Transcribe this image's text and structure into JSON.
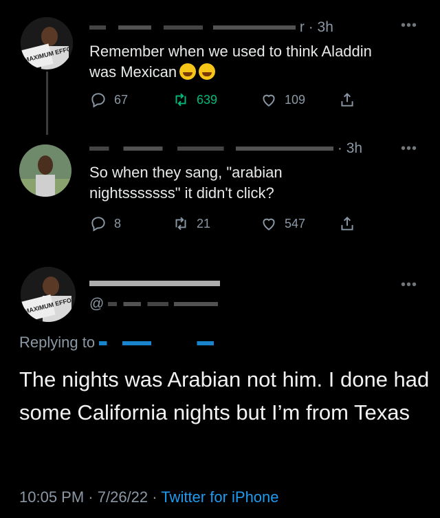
{
  "tweets": [
    {
      "time": "3h",
      "author_suffix": "r",
      "text_line1": "Remember when we used to think Aladdin",
      "text_line2": "was Mexican",
      "replies": "67",
      "retweets": "639",
      "likes": "109",
      "avatar_text": "MAXIMUM EFFORT"
    },
    {
      "time": "3h",
      "text_line1": "So when they sang, \"arabian",
      "text_line2": "nightsssssss\" it didn't click?",
      "replies": "8",
      "retweets": "21",
      "likes": "547"
    }
  ],
  "main_tweet": {
    "handle_prefix": "@",
    "avatar_text": "MAXIMUM EFFORT",
    "replying_label": "Replying to",
    "text": "The nights was Arabian not him. I done had some California nights but I’m from Texas",
    "time": "10:05 PM",
    "date": "7/26/22",
    "source": "Twitter for iPhone"
  },
  "colors": {
    "background": "#000000",
    "text": "#e7e9ea",
    "muted": "#8b98a5",
    "link": "#1d9bf0",
    "retweet_green": "#00ba7c"
  },
  "icons": [
    "reply-icon",
    "retweet-icon",
    "like-icon",
    "share-icon",
    "more-icon"
  ]
}
